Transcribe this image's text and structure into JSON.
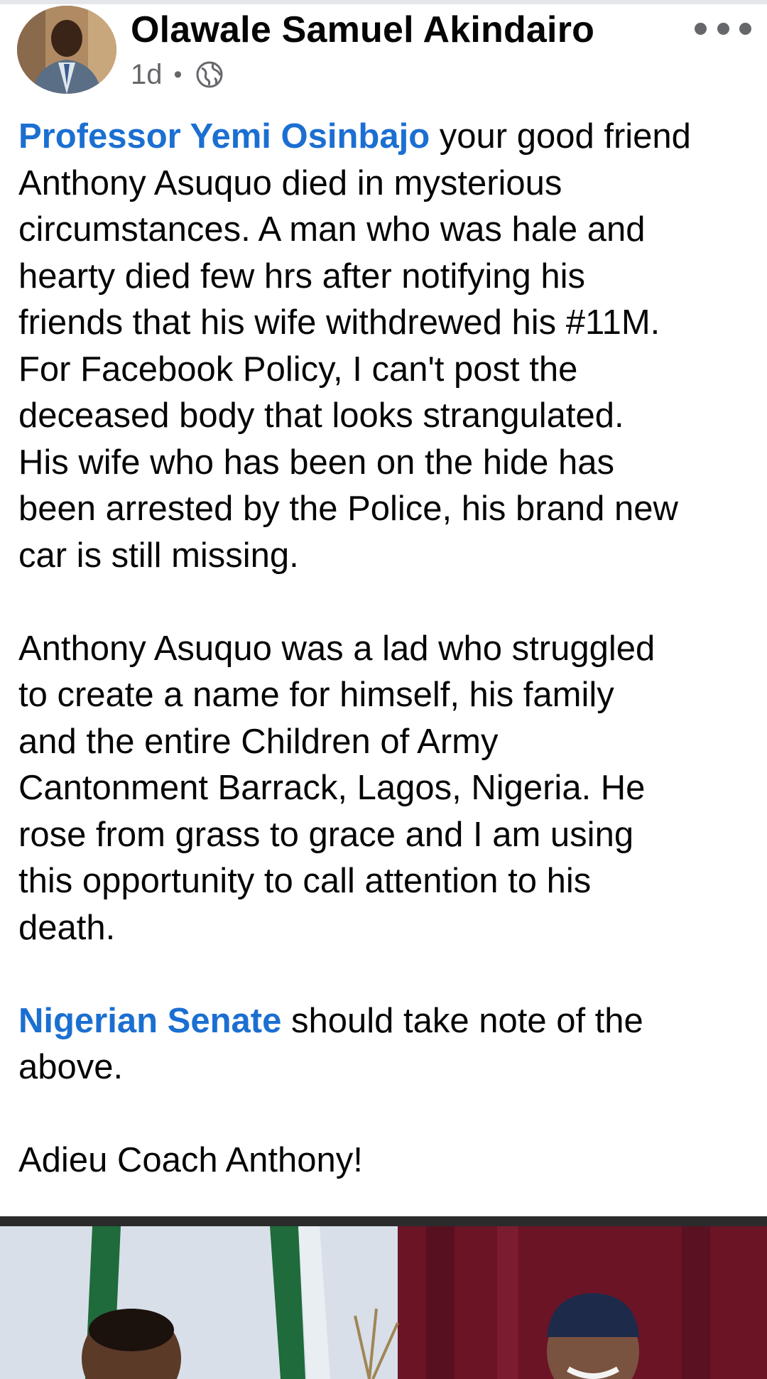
{
  "post": {
    "author": "Olawale Samuel Akindairo",
    "time": "1d",
    "separator": "•",
    "privacy_icon": "globe-icon",
    "more_icon": "more-horizontal-icon",
    "paragraphs": [
      {
        "mention": "Professor Yemi Osinbajo",
        "text": " your good friend\nAnthony Asuquo died in mysterious\ncircumstances. A man who was hale and\nhearty died few hrs after notifying his\nfriends that his wife withdrewed his #11M.\nFor Facebook Policy, I can't post the\ndeceased body that looks strangulated.\nHis wife who has been on the hide has\nbeen arrested by the Police, his brand new\ncar is still missing."
      },
      {
        "mention": "",
        "text": "Anthony Asuquo was a lad who struggled\nto create a name for himself, his family\nand the entire Children of Army\nCantonment Barrack, Lagos, Nigeria. He\nrose from grass to grace and I am using\nthis opportunity to call attention to his\ndeath."
      },
      {
        "mention": "Nigerian Senate",
        "text": " should take note of the\nabove."
      },
      {
        "mention": "",
        "text": "Adieu Coach Anthony!"
      }
    ]
  },
  "colors": {
    "mention": "#1b6fd1",
    "text": "#050505",
    "meta": "#65676b"
  }
}
